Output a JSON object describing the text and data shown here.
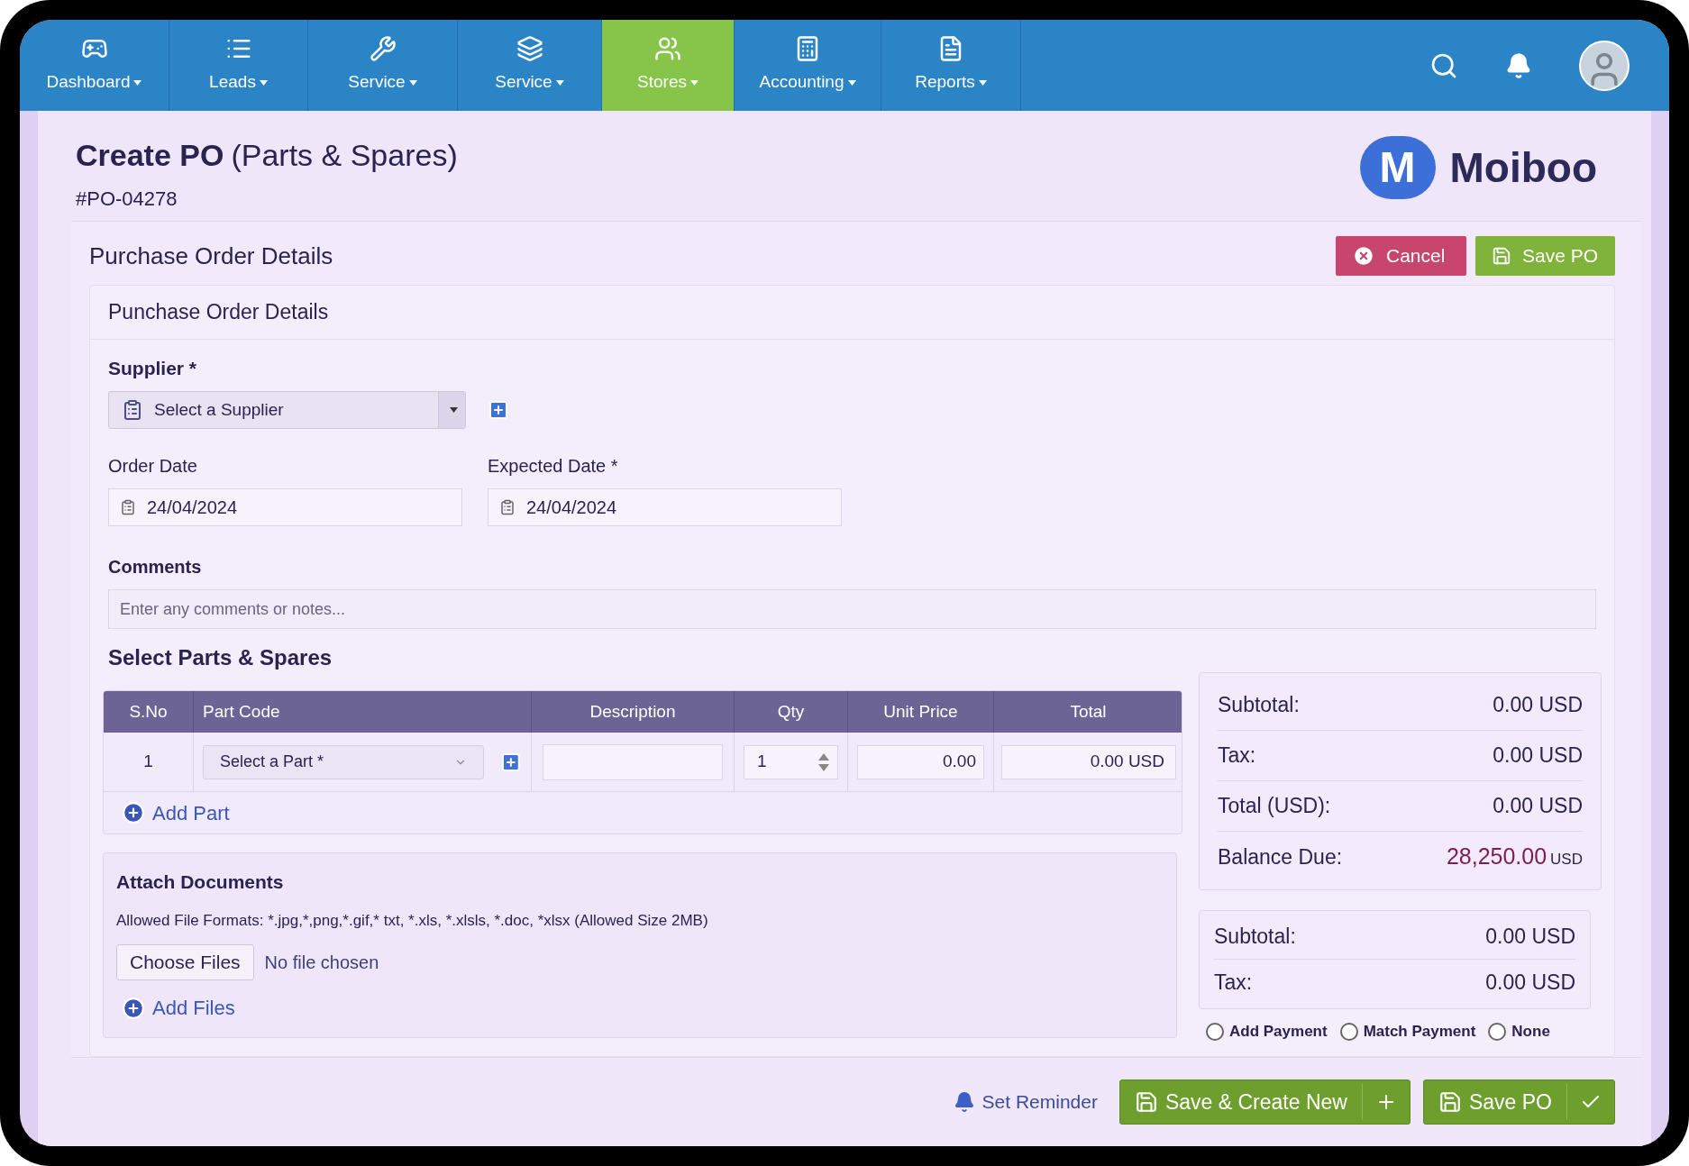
{
  "nav": {
    "items": [
      {
        "label": "Dashboard",
        "selected": false
      },
      {
        "label": "Leads",
        "selected": false
      },
      {
        "label": "Service",
        "selected": false
      },
      {
        "label": "Service",
        "selected": false
      },
      {
        "label": "Stores",
        "selected": true
      },
      {
        "label": "Accounting",
        "selected": false
      },
      {
        "label": "Reports",
        "selected": false
      }
    ]
  },
  "header": {
    "title": "Create PO",
    "subtitle": "(Parts & Spares)",
    "number": "#PO-04278",
    "logo": {
      "mark": "M",
      "name": "Moiboo"
    }
  },
  "panel": {
    "title": "Purchase Order Details",
    "buttons": [
      {
        "label": "Cancel",
        "kind": "cancel"
      },
      {
        "label": "Save PO",
        "kind": "save"
      }
    ]
  },
  "details": {
    "title": "Punchase Order Details",
    "supplier": {
      "label": "Supplier *",
      "placeholder": "Select a Supplier"
    },
    "order_date": {
      "label": "Order Date",
      "value": "24/04/2024"
    },
    "expected_date": {
      "label": "Expected Date *",
      "value": "24/04/2024"
    },
    "comments": {
      "label": "Comments",
      "placeholder": "Enter any comments or notes..."
    }
  },
  "parts": {
    "title": "Select Parts & Spares",
    "columns": [
      "S.No",
      "Part Code",
      "Description",
      "Qty",
      "Unit Price",
      "Total"
    ],
    "rows": [
      {
        "sno": "1",
        "part_placeholder": "Select a Part *",
        "qty": "1",
        "unit_price": "0.00",
        "total": "0.00 USD"
      }
    ],
    "add_label": "Add Part"
  },
  "totals": [
    {
      "label": "Subtotal:",
      "value": "0.00 USD",
      "kind": "amount"
    },
    {
      "label": "Tax:",
      "value": "0.00 USD",
      "kind": "amount"
    },
    {
      "label": "Total (USD):",
      "value": "0.00 USD",
      "kind": "amount"
    },
    {
      "label": "Balance Due:",
      "value": "28,250.00",
      "currency": "USD",
      "kind": "balance"
    }
  ],
  "totals_2": [
    {
      "label": "Subtotal:",
      "value": "0.00 USD"
    },
    {
      "label": "Tax:",
      "value": "0.00 USD"
    }
  ],
  "payment_options": [
    {
      "label": "Add Payment",
      "selected": false
    },
    {
      "label": "Match Payment",
      "selected": false
    },
    {
      "label": "None",
      "selected": false
    }
  ],
  "attach": {
    "title": "Attach Documents",
    "formats": "Allowed File Formats: *.jpg,*,png,*.gif,* txt, *.xls, *.xlsls, *.doc, *xlsx (Allowed Size 2MB)",
    "choose": "Choose Files",
    "status": "No file chosen",
    "add_label": "Add Files"
  },
  "footer": {
    "reminder": "Set Reminder",
    "buttons": [
      {
        "label": "Save & Create New",
        "kind": "plus"
      },
      {
        "label": "Save PO",
        "kind": "check"
      }
    ]
  }
}
